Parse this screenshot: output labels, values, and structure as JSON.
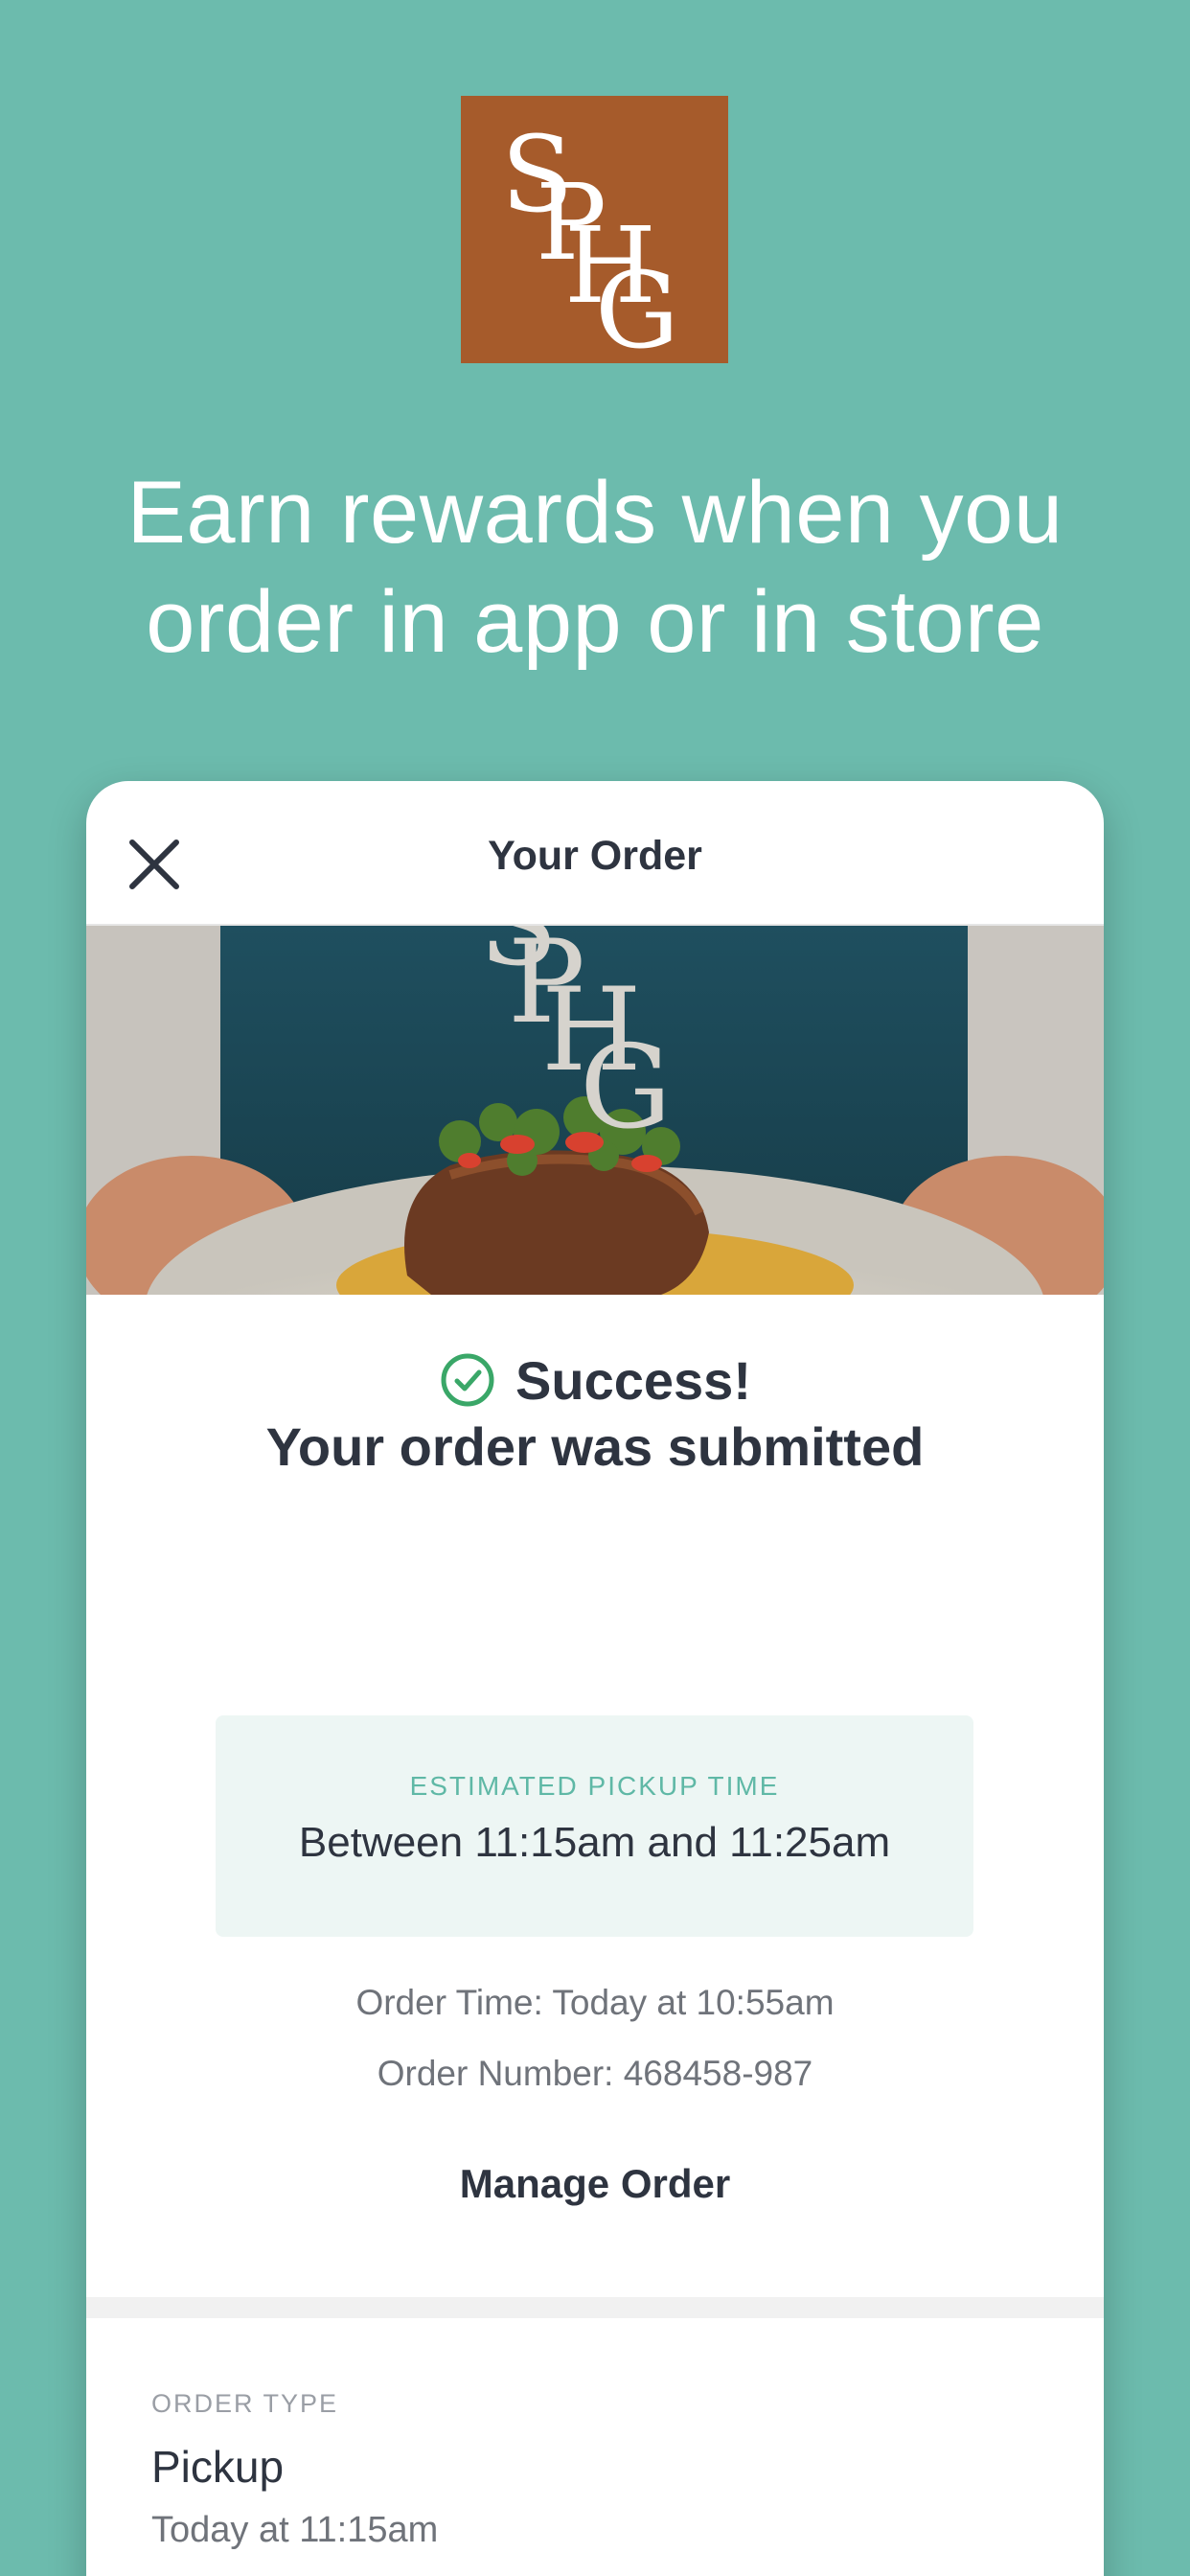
{
  "brand": {
    "logo_text": "SPHG",
    "logo_color": "#a65b2b",
    "background_color": "#6cbbad"
  },
  "headline": {
    "line1": "Earn rewards when you",
    "line2": "order in app or in store"
  },
  "order_screen": {
    "title": "Your Order",
    "close_icon": "close-icon",
    "hero_image": "plated dish held by chef with SPHG logo",
    "success_line1": "Success!",
    "success_line2": "Your order was submitted",
    "success_icon": "check-circle-icon",
    "success_color": "#3aa768",
    "pickup_label": "ESTIMATED PICKUP TIME",
    "pickup_value": "Between 11:15am and 11:25am",
    "order_time": "Order Time: Today at 10:55am",
    "order_number": "Order Number: 468458-987",
    "manage_label": "Manage Order",
    "order_type_label": "ORDER TYPE",
    "order_type": "Pickup",
    "order_type_time": "Today at 11:15am"
  }
}
